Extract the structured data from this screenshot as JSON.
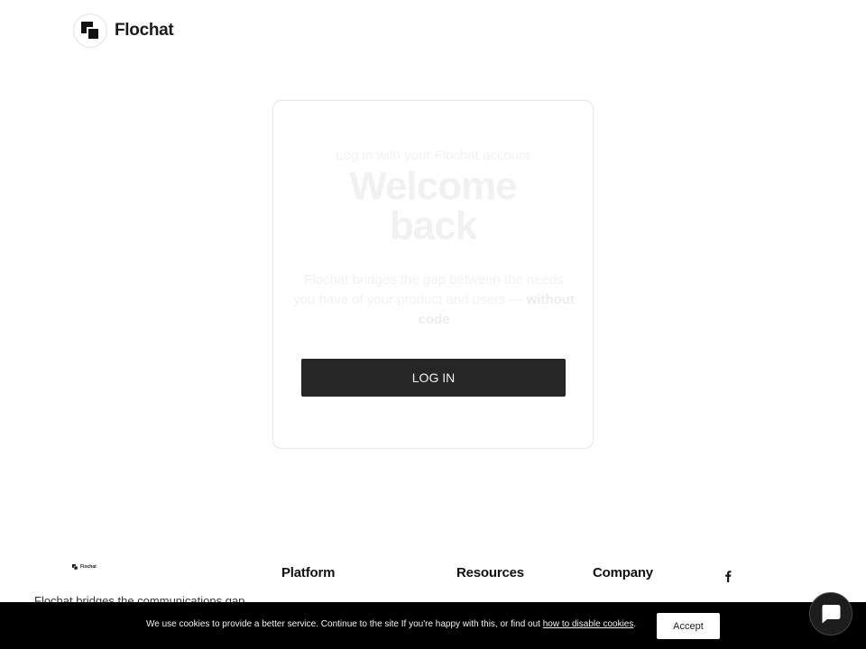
{
  "header": {
    "brand_name": "Flochat",
    "logo_icon": "flochat-logo-icon"
  },
  "login_card": {
    "eyebrow": "Log in with your Flochat account",
    "title_line1": "Welcome",
    "title_line2": "back",
    "description": "Flochat bridges the gap between the needs you have of your product and users —",
    "description_bold": "without code",
    "login_button": "LOG IN"
  },
  "footer": {
    "brand_name": "Flochat",
    "tagline": "Flochat bridges the communications gap",
    "columns": [
      "Platform",
      "Resources",
      "Company"
    ],
    "social_icon": "facebook-icon"
  },
  "cookie_bar": {
    "message": "We use cookies to provide a better service. Continue to the site If you're happy with this, or find out ",
    "link_text": "how to disable cookies",
    "trailing": ".",
    "accept_label": "Accept"
  },
  "chat_widget": {
    "icon": "chat-bubble-icon"
  },
  "colors": {
    "button_dark": "#262626",
    "cookie_bar_bg": "#000000",
    "card_border": "#e6e6e6"
  }
}
